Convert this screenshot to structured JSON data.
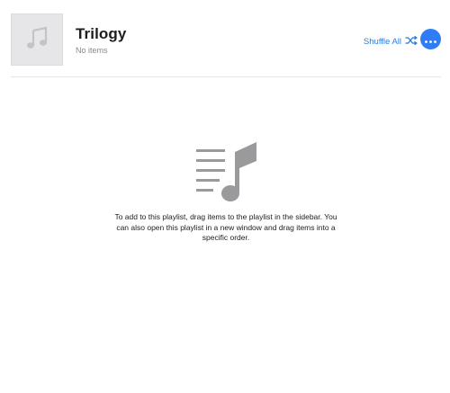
{
  "playlist": {
    "title": "Trilogy",
    "subtitle": "No items"
  },
  "actions": {
    "shuffle_label": "Shuffle All",
    "shuffle_icon": "shuffle-icon",
    "more_icon": "ellipsis-icon"
  },
  "artwork": {
    "icon": "music-note-icon"
  },
  "empty_state": {
    "icon": "playlist-note-icon",
    "message": "To add to this playlist, drag items to the playlist in the sidebar. You can also open this playlist in a new window and drag items into a specific order."
  },
  "colors": {
    "accent": "#2f7cf6",
    "link": "#2a7ae2",
    "artwork_bg": "#e6e6e8",
    "icon_gray": "#9a9a9c"
  }
}
